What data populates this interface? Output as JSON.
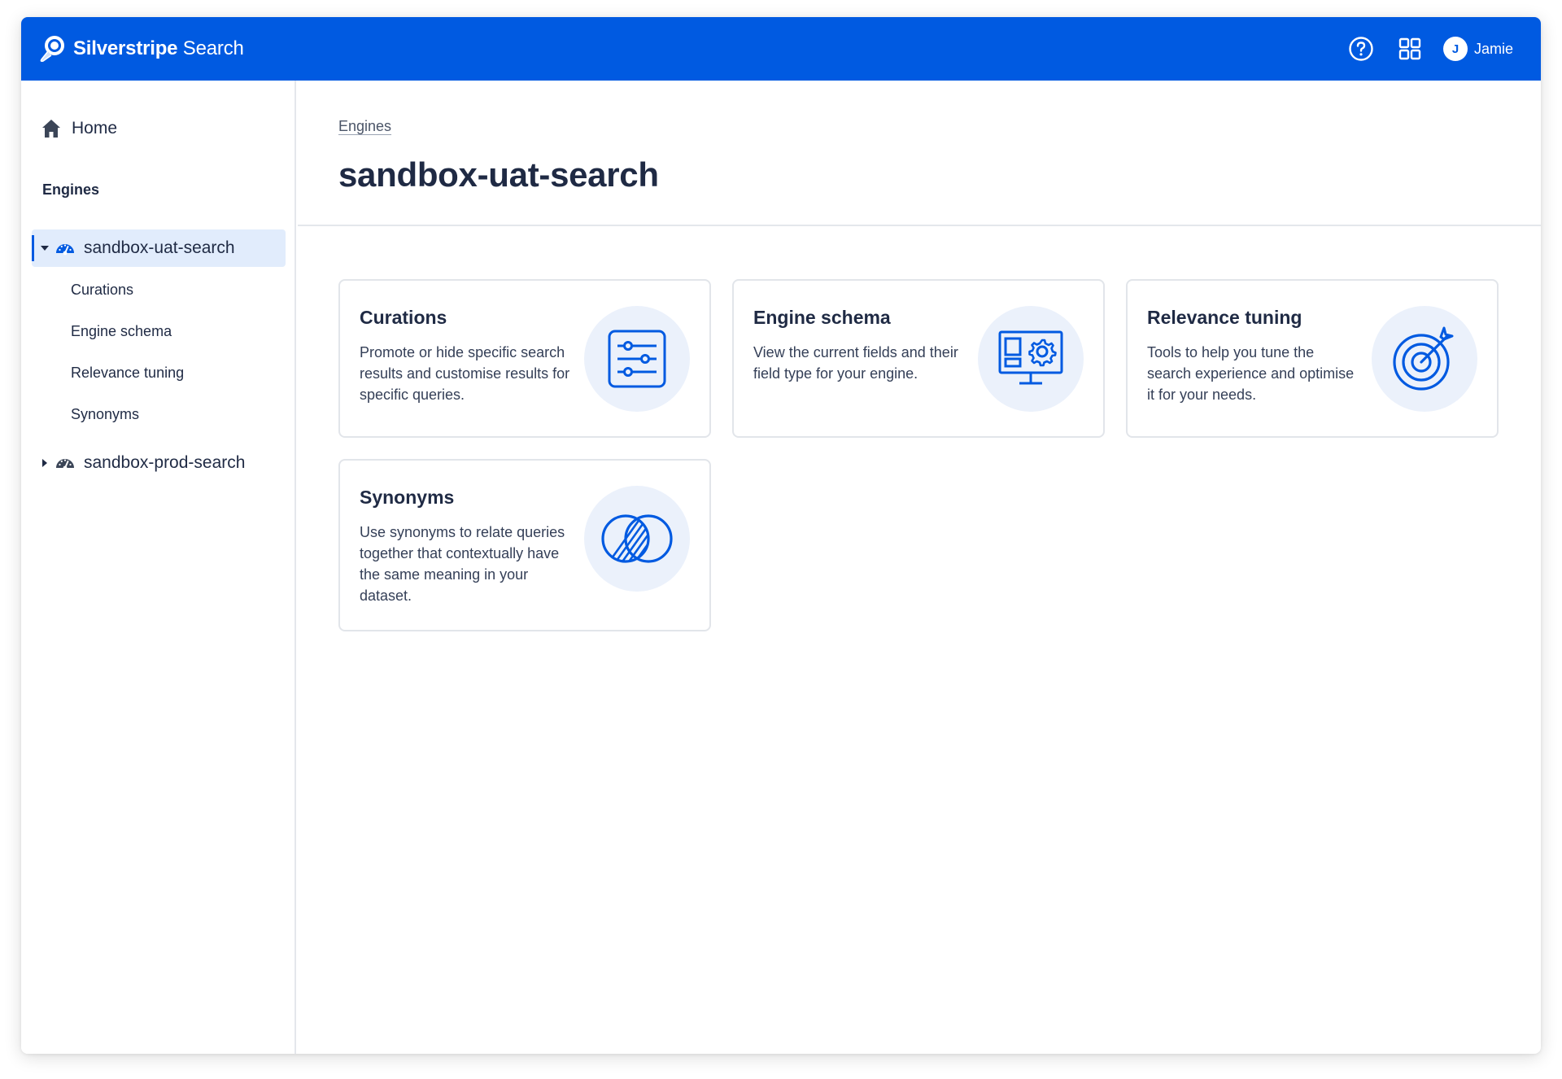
{
  "brand": {
    "name_bold": "Silverstripe",
    "name_light": " Search"
  },
  "header": {
    "help_icon": "question-circle-icon",
    "apps_icon": "grid-icon",
    "user": {
      "initial": "J",
      "name": "Jamie"
    }
  },
  "sidebar": {
    "home_label": "Home",
    "engines_title": "Engines",
    "engines": [
      {
        "label": "sandbox-uat-search",
        "expanded": true,
        "children": [
          "Curations",
          "Engine schema",
          "Relevance tuning",
          "Synonyms"
        ]
      },
      {
        "label": "sandbox-prod-search",
        "expanded": false
      }
    ]
  },
  "main": {
    "breadcrumb": "Engines",
    "title": "sandbox-uat-search",
    "cards": [
      {
        "title": "Curations",
        "description": "Promote or hide specific search results and customise results for specific queries.",
        "icon": "sliders-icon"
      },
      {
        "title": "Engine schema",
        "description": "View the current fields and their field type for your engine.",
        "icon": "monitor-gear-icon"
      },
      {
        "title": "Relevance tuning",
        "description": "Tools to help you tune the search experience and optimise it for your needs.",
        "icon": "target-icon"
      },
      {
        "title": "Synonyms",
        "description": "Use synonyms to relate queries together that contextually have the same meaning in your dataset.",
        "icon": "overlapping-circles-icon"
      }
    ]
  },
  "colors": {
    "brand_blue": "#005ae1",
    "active_bg": "#e1ecfc",
    "icon_bg": "#ebf1fb"
  }
}
